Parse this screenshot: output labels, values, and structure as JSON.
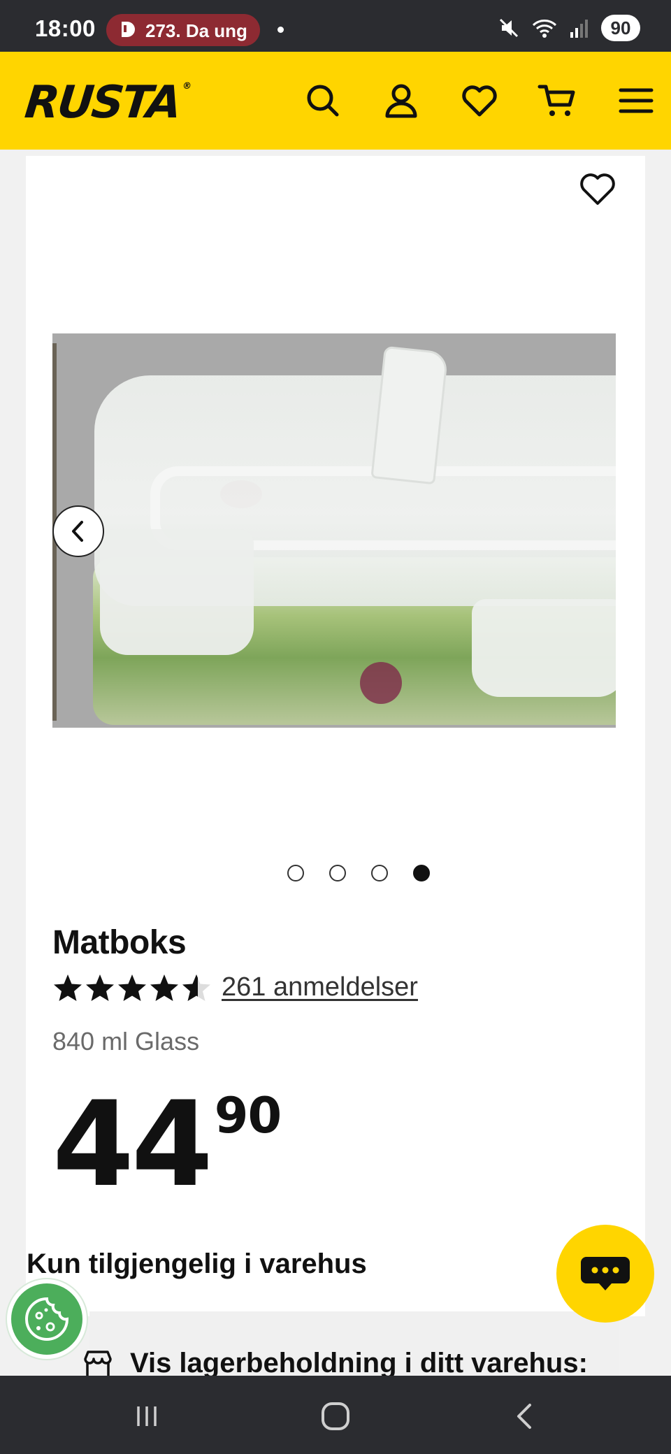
{
  "status_bar": {
    "time": "18:00",
    "notification_text": "273. Da ung",
    "battery": "90",
    "icons": [
      "notification-app-icon",
      "mute-icon",
      "wifi-icon",
      "signal-icon",
      "battery-icon"
    ]
  },
  "header": {
    "logo": "RUSTA",
    "logo_mark": "®",
    "icons": [
      "search-icon",
      "account-icon",
      "heart-icon",
      "cart-icon",
      "menu-icon"
    ],
    "brand_color": "#ffd500"
  },
  "gallery": {
    "slide_count": 4,
    "active_slide": 4,
    "prev_icon": "chevron-left-icon",
    "favorite_icon": "heart-icon"
  },
  "product": {
    "title": "Matboks",
    "rating": 4.5,
    "rating_max": 5,
    "reviews": "261 anmeldelser",
    "variant": "840 ml Glass",
    "price_main": "44",
    "price_decimals": "90",
    "availability": "Kun tilgjengelig i varehus",
    "stock_link": "Vis lagerbeholdning i ditt varehus:",
    "stock_icon": "store-icon"
  },
  "floating": {
    "chat_icon": "chat-icon",
    "cookie_icon": "cookie-icon"
  },
  "navbar": {
    "icons": [
      "recent-apps-icon",
      "home-icon",
      "back-icon"
    ]
  }
}
